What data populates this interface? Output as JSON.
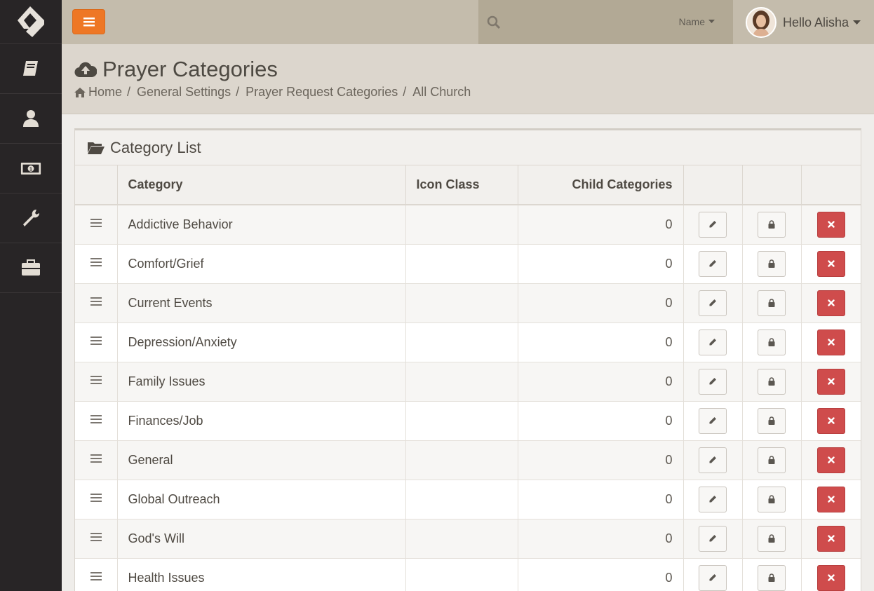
{
  "header": {
    "search_filter_label": "Name",
    "greeting": "Hello Alisha"
  },
  "page": {
    "title": "Prayer Categories",
    "breadcrumbs": [
      "Home",
      "General Settings",
      "Prayer Request Categories",
      "All Church"
    ],
    "breadcrumb_sep": "/"
  },
  "panel": {
    "title": "Category List",
    "columns": {
      "category": "Category",
      "icon_class": "Icon Class",
      "child_categories": "Child Categories"
    },
    "rows": [
      {
        "category": "Addictive Behavior",
        "icon_class": "",
        "child_categories": "0"
      },
      {
        "category": "Comfort/Grief",
        "icon_class": "",
        "child_categories": "0"
      },
      {
        "category": "Current Events",
        "icon_class": "",
        "child_categories": "0"
      },
      {
        "category": "Depression/Anxiety",
        "icon_class": "",
        "child_categories": "0"
      },
      {
        "category": "Family Issues",
        "icon_class": "",
        "child_categories": "0"
      },
      {
        "category": "Finances/Job",
        "icon_class": "",
        "child_categories": "0"
      },
      {
        "category": "General",
        "icon_class": "",
        "child_categories": "0"
      },
      {
        "category": "Global Outreach",
        "icon_class": "",
        "child_categories": "0"
      },
      {
        "category": "God's Will",
        "icon_class": "",
        "child_categories": "0"
      },
      {
        "category": "Health Issues",
        "icon_class": "",
        "child_categories": "0"
      }
    ]
  },
  "colors": {
    "accent": "#ee7725",
    "danger": "#cf4c4c",
    "sidebar": "#282526",
    "topbar": "#c4bcac"
  },
  "icons": {
    "nav": [
      "book-icon",
      "person-icon",
      "money-icon",
      "wrench-icon",
      "briefcase-icon"
    ]
  }
}
